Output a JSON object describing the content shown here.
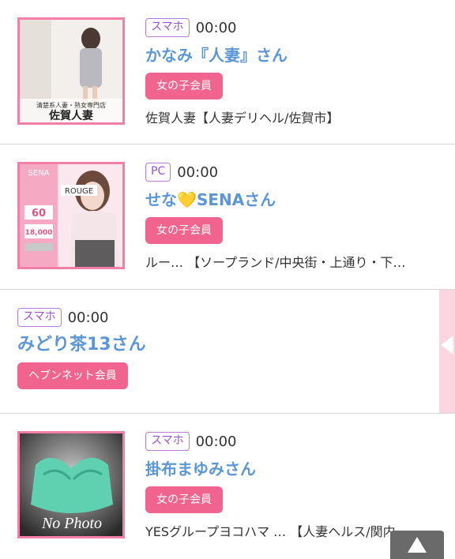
{
  "entries": [
    {
      "device": "スマホ",
      "time": "00:00",
      "name": "かなみ『人妻』さん",
      "member": "女の子会員",
      "shop": "佐賀人妻【人妻デリヘル/佐賀市】",
      "thumb_text_1": "清楚系人妻・熟女専門店",
      "thumb_text_2": "佐賀人妻"
    },
    {
      "device": "PC",
      "time": "00:00",
      "name": "せな💛SENAさん",
      "member": "女の子会員",
      "shop": "ルー… 【ソープランド/中央街・上通り・下…",
      "thumb_text_1": "SENA",
      "thumb_text_2": "ROUGE",
      "thumb_text_3": "60",
      "thumb_text_4": "18,000"
    },
    {
      "device": "スマホ",
      "time": "00:00",
      "name": "みどり茶13さん",
      "member": "ヘブンネット会員"
    },
    {
      "device": "スマホ",
      "time": "00:00",
      "name": "掛布まゆみさん",
      "member": "女の子会員",
      "shop": "YESグループヨコハマ … 【人妻ヘルス/関内…",
      "thumb_text_1": "No Photo"
    }
  ],
  "colors": {
    "name": "#5b97d8",
    "member_badge": "#f0648f",
    "device_badge": "#9c4fd6",
    "thumb_border": "#f47fa6"
  },
  "icons": {
    "scroll_top": "arrow-up-icon",
    "side_tab": "chevron-left-icon"
  }
}
